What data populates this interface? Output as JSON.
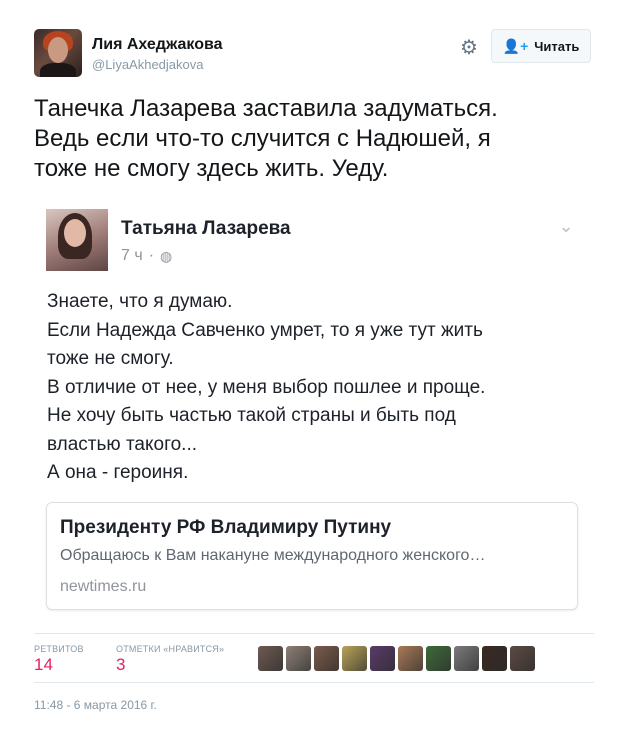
{
  "author": {
    "name": "Лия Ахеджакова",
    "handle": "@LiyaAkhedjakova"
  },
  "follow_button": {
    "label": "Читать",
    "icon": "add-user-icon"
  },
  "settings_icon": "gear-icon",
  "tweet_text": "Танечка Лазарева заставила задуматься.\nВедь если что-то случится с Надюшей, я\nтоже не смогу здесь жить. Уеду.",
  "embedded_post": {
    "author_name": "Татьяна Лазарева",
    "time": "7 ч",
    "separator": "·",
    "privacy_icon": "globe-icon",
    "body": "Знаете, что я думаю.\nЕсли Надежда Савченко умрет, то я уже тут жить\nтоже не смогу.\nВ отличие от нее, у меня выбор пошлее и проще.\nНе хочу быть частью такой страны и быть под\nвластью такого...\nА она - героиня.",
    "link": {
      "title": "Президенту РФ Владимиру Путину",
      "description": "Обращаюсь к Вам накануне международного женского…",
      "domain": "newtimes.ru"
    }
  },
  "stats": {
    "retweets_label": "РЕТВИТОВ",
    "retweets_count": "14",
    "likes_label": "ОТМЕТКИ «НРАВИТСЯ»",
    "likes_count": "3"
  },
  "likers": [
    {
      "color": "#6d5a52"
    },
    {
      "color": "#8d8076"
    },
    {
      "color": "#7a5b4b"
    },
    {
      "color": "#b9a35a"
    },
    {
      "color": "#5a3a6a"
    },
    {
      "color": "#a97a58"
    },
    {
      "color": "#3f6a3a"
    },
    {
      "color": "#7b7b7b"
    },
    {
      "color": "#3a2a22"
    },
    {
      "color": "#5b4a44"
    }
  ],
  "timestamp": "11:48 - 6 марта 2016 г.",
  "colors": {
    "accent": "#1da1f2",
    "like_red": "#e0245e",
    "muted": "#8899a6"
  }
}
